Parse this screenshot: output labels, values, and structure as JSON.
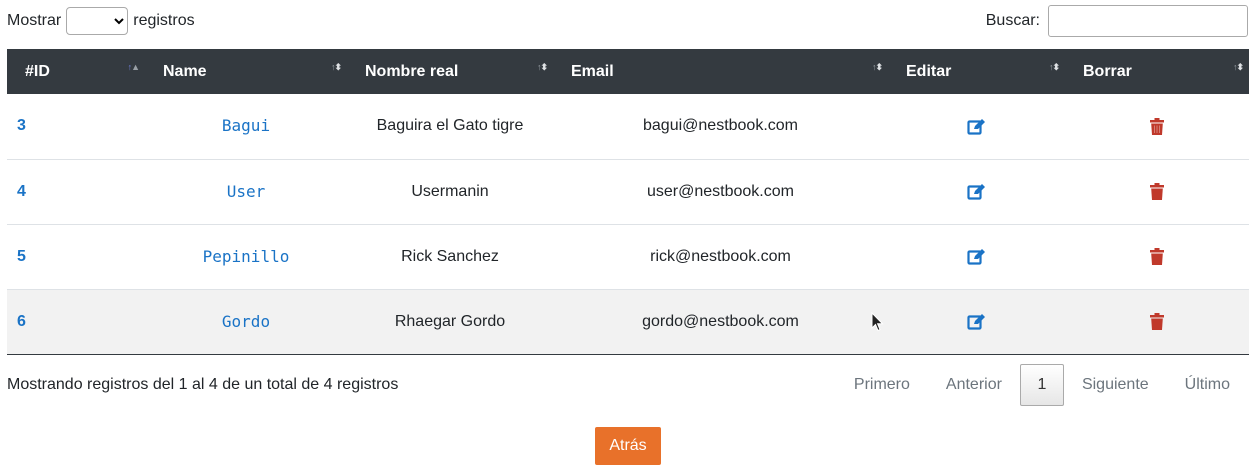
{
  "length": {
    "prefix": "Mostrar",
    "selected": "",
    "suffix": "registros"
  },
  "search": {
    "label": "Buscar:",
    "value": ""
  },
  "table": {
    "headers": [
      "#ID",
      "Name",
      "Nombre real",
      "Email",
      "Editar",
      "Borrar"
    ],
    "rows": [
      {
        "id": "3",
        "name": "Bagui",
        "real_name": "Baguira el Gato tigre",
        "email": "bagui@nestbook.com"
      },
      {
        "id": "4",
        "name": "User",
        "real_name": "Usermanin",
        "email": "user@nestbook.com"
      },
      {
        "id": "5",
        "name": "Pepinillo",
        "real_name": "Rick Sanchez",
        "email": "rick@nestbook.com"
      },
      {
        "id": "6",
        "name": "Gordo",
        "real_name": "Rhaegar Gordo",
        "email": "gordo@nestbook.com"
      }
    ]
  },
  "info": "Mostrando registros del 1 al 4 de un total de 4 registros",
  "pagination": {
    "first": "Primero",
    "prev": "Anterior",
    "current": "1",
    "next": "Siguiente",
    "last": "Último"
  },
  "back_button": "Atrás",
  "colors": {
    "header_bg": "#343a40",
    "link": "#1a73c6",
    "edit_icon": "#1a73c6",
    "delete_icon": "#c0392b",
    "back_button": "#e8712a"
  },
  "icons": {
    "edit": "edit-icon",
    "delete": "trash-icon",
    "cursor": "mouse-cursor-icon"
  }
}
